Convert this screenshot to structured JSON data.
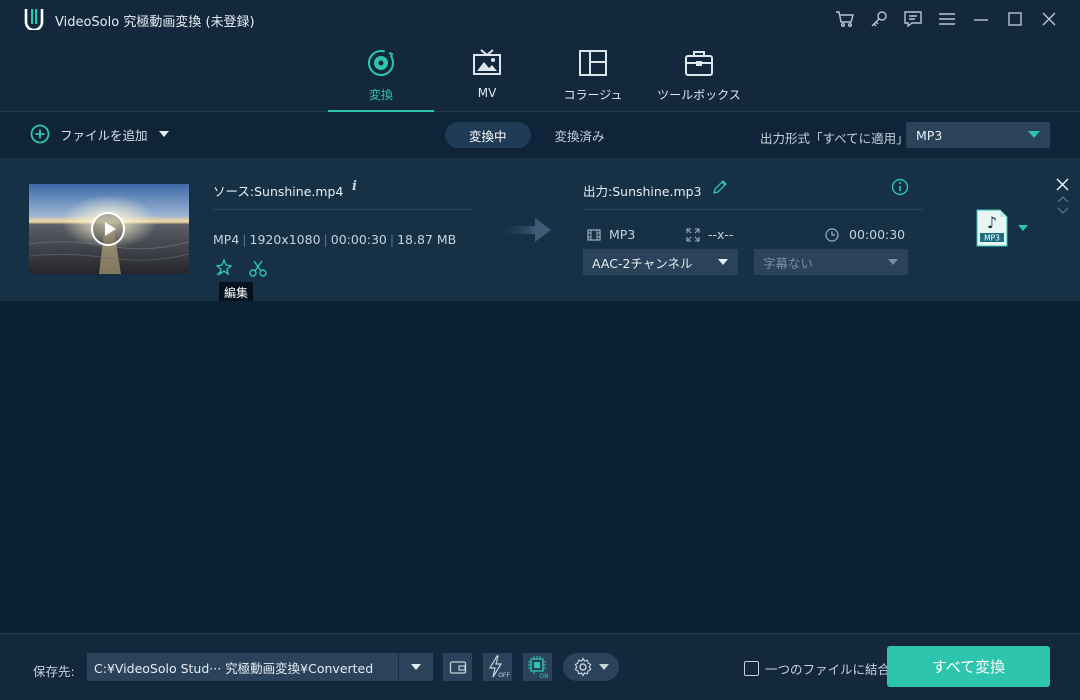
{
  "window": {
    "title": "VideoSolo 究極動画変換 (未登録)",
    "title_icons": [
      "cart-icon",
      "key-icon",
      "feedback-icon",
      "menu-icon",
      "minimize-icon",
      "maximize-icon",
      "close-icon"
    ]
  },
  "nav": {
    "tabs": [
      {
        "label": "変換",
        "icon": "convert-icon",
        "active": true
      },
      {
        "label": "MV",
        "icon": "mv-icon",
        "active": false
      },
      {
        "label": "コラージュ",
        "icon": "collage-icon",
        "active": false
      },
      {
        "label": "ツールボックス",
        "icon": "toolbox-icon",
        "active": false
      }
    ]
  },
  "toolbar": {
    "add_file_label": "ファイルを追加",
    "segments": [
      "変換中",
      "変換済み"
    ],
    "active_segment": "変換中",
    "output_format_label": "出力形式「すべてに適用」:",
    "output_format_value": "MP3"
  },
  "file": {
    "source_name": "ソース:Sunshine.mp4",
    "info_glyph": "i",
    "meta": {
      "format": "MP4",
      "resolution": "1920x1080",
      "duration": "00:00:30",
      "size": "18.87 MB"
    },
    "tooltip": "編集",
    "output_name": "出力:Sunshine.mp3",
    "output_format": "MP3",
    "output_resolution": "--x--",
    "output_duration": "00:00:30",
    "audio_track": "AAC-2チャンネル",
    "subtitle": "字幕ない",
    "badge_label": "MP3"
  },
  "bottom": {
    "save_label": "保存先:",
    "path": "C:¥VideoSolo Stud··· 究極動画変換¥Converted",
    "merge_label": "一つのファイルに結合",
    "merge_checked": false,
    "convert_all_label": "すべて変換"
  },
  "colors": {
    "accent": "#2ec5ae",
    "background": "#0e2337",
    "panel": "#13283c",
    "row": "#163046"
  }
}
